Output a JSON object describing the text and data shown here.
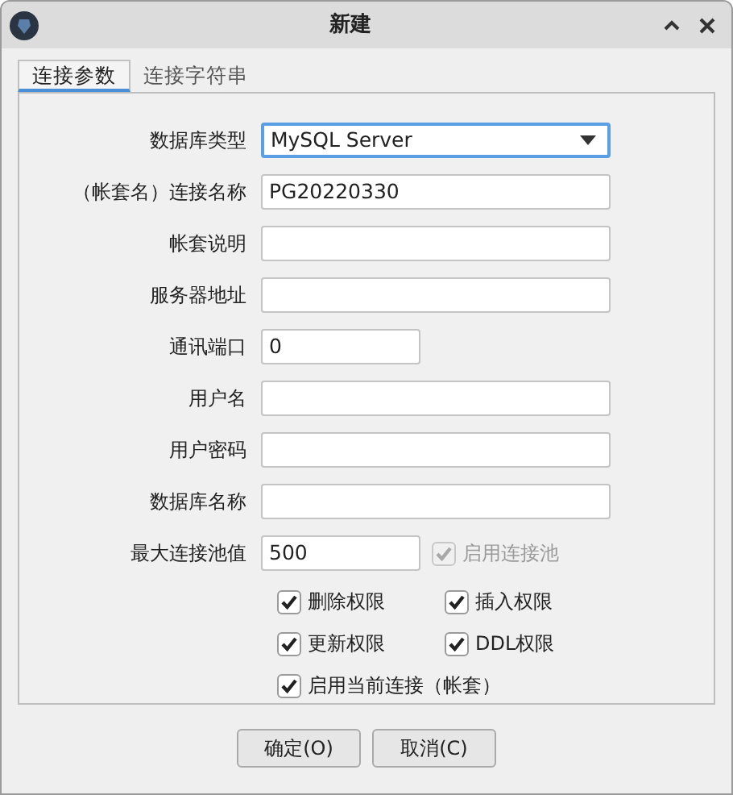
{
  "window": {
    "title": "新建"
  },
  "tabs": [
    {
      "label": "连接参数",
      "selected": true
    },
    {
      "label": "连接字符串",
      "selected": false
    }
  ],
  "fields": [
    {
      "label": "数据库类型",
      "kind": "select",
      "value": "MySQL Server",
      "focused": true
    },
    {
      "label": "（帐套名）连接名称",
      "kind": "text",
      "value": "PG20220330",
      "focused": false
    },
    {
      "label": "帐套说明",
      "kind": "text",
      "focused": false
    },
    {
      "label": "服务器地址",
      "kind": "text",
      "focused": false
    },
    {
      "label": "通讯端口",
      "kind": "number",
      "value": "0",
      "focused": false
    },
    {
      "label": "用户名",
      "kind": "text",
      "focused": false
    },
    {
      "label": "用户密码",
      "kind": "text",
      "focused": false
    },
    {
      "label": "数据库名称",
      "kind": "text",
      "focused": false
    },
    {
      "label": "最大连接池值",
      "kind": "number",
      "value": "500",
      "focused": false,
      "side_checkbox": {
        "label": "启用连接池",
        "checked": true,
        "disabled": true
      }
    }
  ],
  "checkboxes": [
    {
      "label": "删除权限",
      "checked": true
    },
    {
      "label": "插入权限",
      "checked": true
    },
    {
      "label": "更新权限",
      "checked": true
    },
    {
      "label": "DDL权限",
      "checked": true
    },
    {
      "label": "启用当前连接（帐套）",
      "checked": true
    }
  ],
  "buttons": [
    "确定(O)",
    "取消(C)"
  ]
}
